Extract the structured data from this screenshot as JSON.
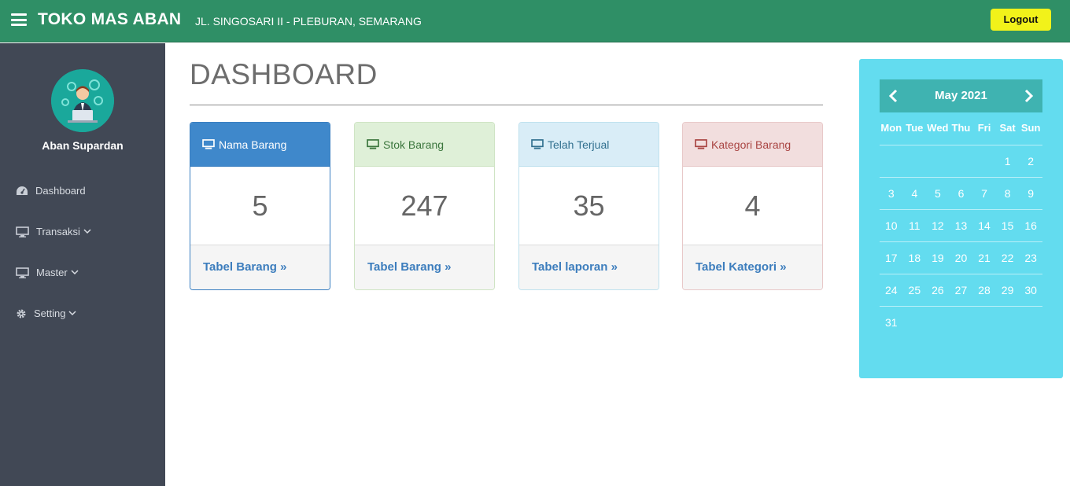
{
  "header": {
    "brand": "TOKO MAS ABAN",
    "address": "JL. SINGOSARI II - PLEBURAN, SEMARANG",
    "logout_label": "Logout"
  },
  "sidebar": {
    "user_name": "Aban Supardan",
    "items": [
      {
        "label": "Dashboard",
        "icon": "dashboard-icon"
      },
      {
        "label": "Transaksi",
        "icon": "monitor-icon"
      },
      {
        "label": "Master",
        "icon": "monitor-icon"
      },
      {
        "label": "Setting",
        "icon": "gear-icon"
      }
    ]
  },
  "main": {
    "title": "DASHBOARD",
    "cards": [
      {
        "title": "Nama Barang",
        "value": "5",
        "link": "Tabel Barang »"
      },
      {
        "title": "Stok Barang",
        "value": "247",
        "link": "Tabel Barang »"
      },
      {
        "title": "Telah Terjual",
        "value": "35",
        "link": "Tabel laporan »"
      },
      {
        "title": "Kategori Barang",
        "value": "4",
        "link": "Tabel Kategori »"
      }
    ]
  },
  "calendar": {
    "month_label": "May 2021",
    "days_of_week": [
      "Mon",
      "Tue",
      "Wed",
      "Thu",
      "Fri",
      "Sat",
      "Sun"
    ],
    "weeks": [
      [
        "",
        "",
        "",
        "",
        "",
        "1",
        "2"
      ],
      [
        "3",
        "4",
        "5",
        "6",
        "7",
        "8",
        "9"
      ],
      [
        "10",
        "11",
        "12",
        "13",
        "14",
        "15",
        "16"
      ],
      [
        "17",
        "18",
        "19",
        "20",
        "21",
        "22",
        "23"
      ],
      [
        "24",
        "25",
        "26",
        "27",
        "28",
        "29",
        "30"
      ],
      [
        "31",
        "",
        "",
        "",
        "",
        "",
        ""
      ]
    ]
  },
  "colors": {
    "topbar": "#2f8f66",
    "sidebar": "#414855",
    "logout_button": "#f2f21a",
    "calendar_bg": "#63dcef",
    "calendar_header": "#3fb3b1",
    "link": "#3c7dbd"
  }
}
